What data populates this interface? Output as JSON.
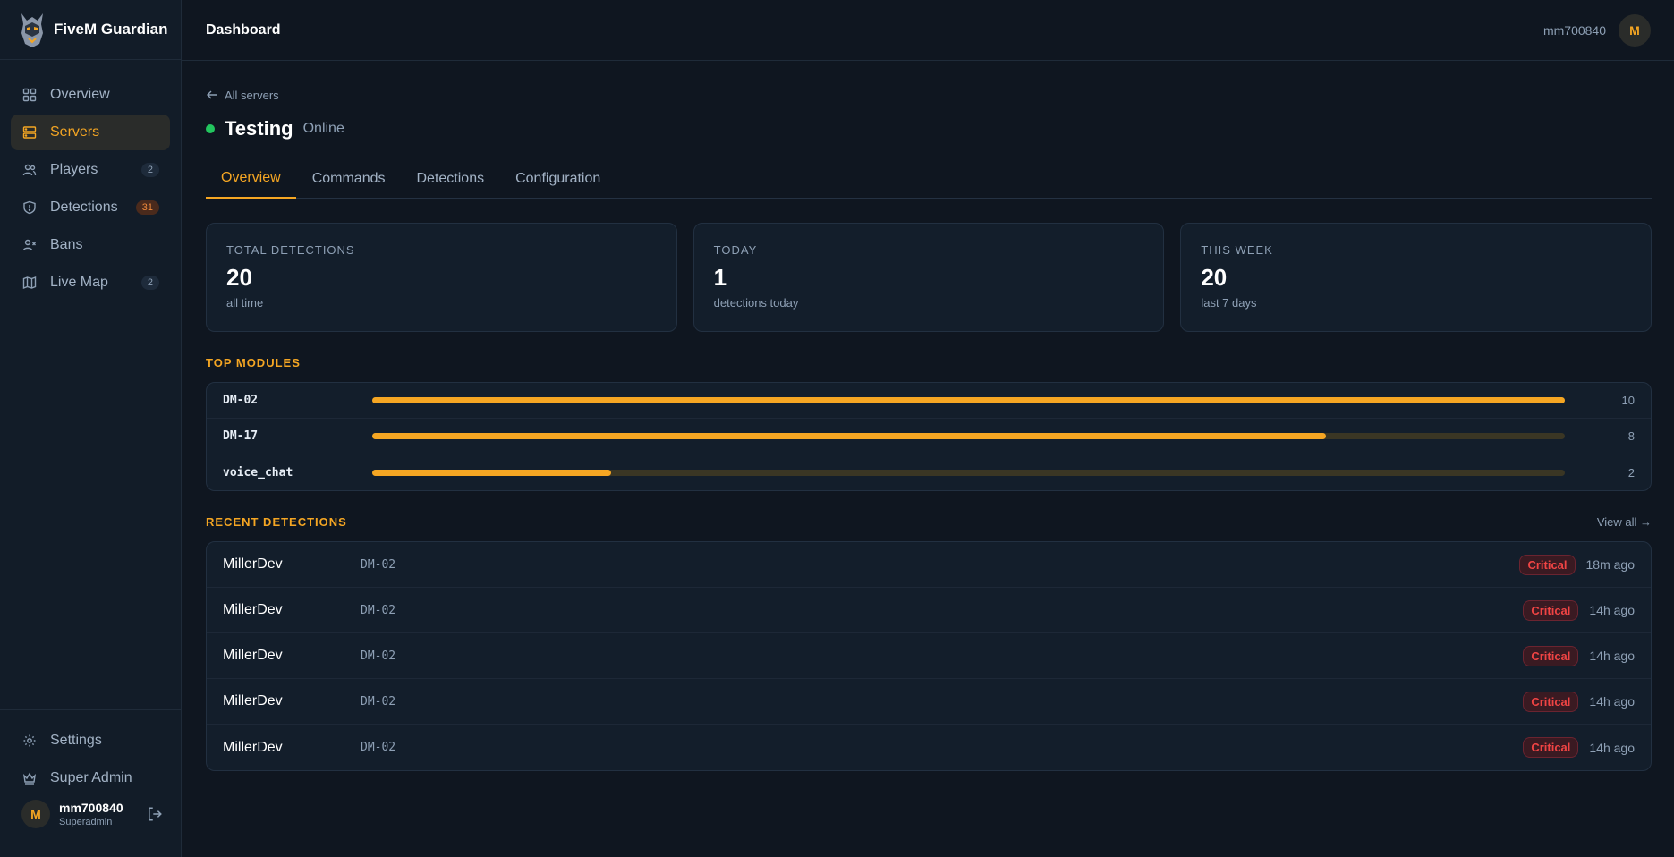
{
  "brand": {
    "name": "FiveM Guardian"
  },
  "sidebar": {
    "items": [
      {
        "label": "Overview",
        "icon": "grid-icon",
        "badge": ""
      },
      {
        "label": "Servers",
        "icon": "server-icon",
        "badge": ""
      },
      {
        "label": "Players",
        "icon": "users-icon",
        "badge": "2"
      },
      {
        "label": "Detections",
        "icon": "shield-icon",
        "badge": "31"
      },
      {
        "label": "Bans",
        "icon": "user-x-icon",
        "badge": ""
      },
      {
        "label": "Live Map",
        "icon": "map-icon",
        "badge": "2"
      }
    ],
    "bottom": [
      {
        "label": "Settings",
        "icon": "gear-icon"
      },
      {
        "label": "Super Admin",
        "icon": "crown-icon"
      }
    ],
    "user": {
      "initial": "M",
      "name": "mm700840",
      "role": "Superadmin"
    }
  },
  "header": {
    "title": "Dashboard",
    "username": "mm700840",
    "initial": "M"
  },
  "server": {
    "back_label": "All servers",
    "name": "Testing",
    "status": "Online",
    "status_color": "#22c55e"
  },
  "tabs": [
    {
      "label": "Overview"
    },
    {
      "label": "Commands"
    },
    {
      "label": "Detections"
    },
    {
      "label": "Configuration"
    }
  ],
  "stats": [
    {
      "label": "TOTAL DETECTIONS",
      "value": "20",
      "sub": "all time"
    },
    {
      "label": "TODAY",
      "value": "1",
      "sub": "detections today"
    },
    {
      "label": "THIS WEEK",
      "value": "20",
      "sub": "last 7 days"
    }
  ],
  "top_modules": {
    "title": "TOP MODULES",
    "rows": [
      {
        "name": "DM-02",
        "count": 10,
        "fraction": 1.0
      },
      {
        "name": "DM-17",
        "count": 8,
        "fraction": 0.8
      },
      {
        "name": "voice_chat",
        "count": 2,
        "fraction": 0.2
      }
    ]
  },
  "recent": {
    "title": "RECENT DETECTIONS",
    "view_all": "View all →",
    "rows": [
      {
        "player": "MillerDev",
        "module": "DM-02",
        "severity": "Critical",
        "time": "18m ago"
      },
      {
        "player": "MillerDev",
        "module": "DM-02",
        "severity": "Critical",
        "time": "14h ago"
      },
      {
        "player": "MillerDev",
        "module": "DM-02",
        "severity": "Critical",
        "time": "14h ago"
      },
      {
        "player": "MillerDev",
        "module": "DM-02",
        "severity": "Critical",
        "time": "14h ago"
      },
      {
        "player": "MillerDev",
        "module": "DM-02",
        "severity": "Critical",
        "time": "14h ago"
      }
    ]
  },
  "colors": {
    "accent": "#f5a623",
    "critical": "#f04444",
    "online": "#22c55e"
  }
}
